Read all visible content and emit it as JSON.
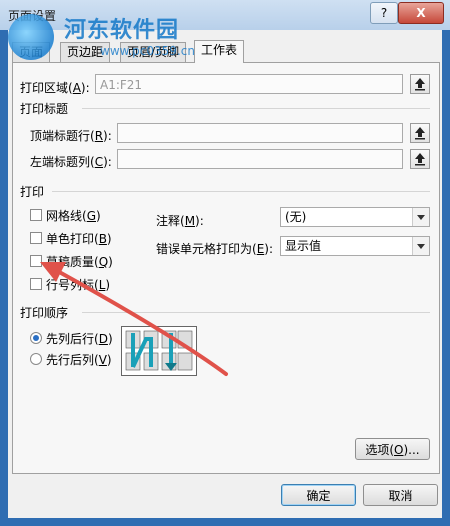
{
  "window": {
    "title": "页面设置",
    "help_label": "?",
    "close_label": "X"
  },
  "watermark": {
    "text": "河东软件园",
    "url": "www.pc0359.cn"
  },
  "tabs": [
    {
      "label": "页面",
      "active": false
    },
    {
      "label": "页边距",
      "active": false
    },
    {
      "label": "页眉/页脚",
      "active": false
    },
    {
      "label": "工作表",
      "active": true
    }
  ],
  "print_area": {
    "label_prefix": "打印区域(",
    "hotkey": "A",
    "label_suffix": "):",
    "value": "A1:F21"
  },
  "print_titles": {
    "heading": "打印标题",
    "rows_label_prefix": "顶端标题行(",
    "rows_hotkey": "R",
    "rows_label_suffix": "):",
    "rows_value": "",
    "cols_label_prefix": "左端标题列(",
    "cols_hotkey": "C",
    "cols_label_suffix": "):",
    "cols_value": ""
  },
  "print": {
    "heading": "打印",
    "gridlines": {
      "prefix": "网格线(",
      "hotkey": "G",
      "suffix": ")",
      "checked": false
    },
    "black_white": {
      "prefix": "单色打印(",
      "hotkey": "B",
      "suffix": ")",
      "checked": false
    },
    "draft": {
      "prefix": "草稿质量(",
      "hotkey": "Q",
      "suffix": ")",
      "checked": false
    },
    "headings": {
      "prefix": "行号列标(",
      "hotkey": "L",
      "suffix": ")",
      "checked": false
    },
    "comments": {
      "prefix": "注释(",
      "hotkey": "M",
      "suffix": "):",
      "value": "(无)"
    },
    "cell_errors": {
      "prefix": "错误单元格打印为(",
      "hotkey": "E",
      "suffix": "):",
      "value": "显示值"
    }
  },
  "page_order": {
    "heading": "打印顺序",
    "down_then_over": {
      "prefix": "先列后行(",
      "hotkey": "D",
      "suffix": ")",
      "selected": true
    },
    "over_then_down": {
      "prefix": "先行后列(",
      "hotkey": "V",
      "suffix": ")",
      "selected": false
    }
  },
  "options_button": {
    "prefix": "选项(",
    "hotkey": "O",
    "suffix": ")..."
  },
  "ok_button": "确定",
  "cancel_button": "取消",
  "colors": {
    "accent": "#2a6fc4",
    "annotation_arrow": "#e0524a"
  }
}
